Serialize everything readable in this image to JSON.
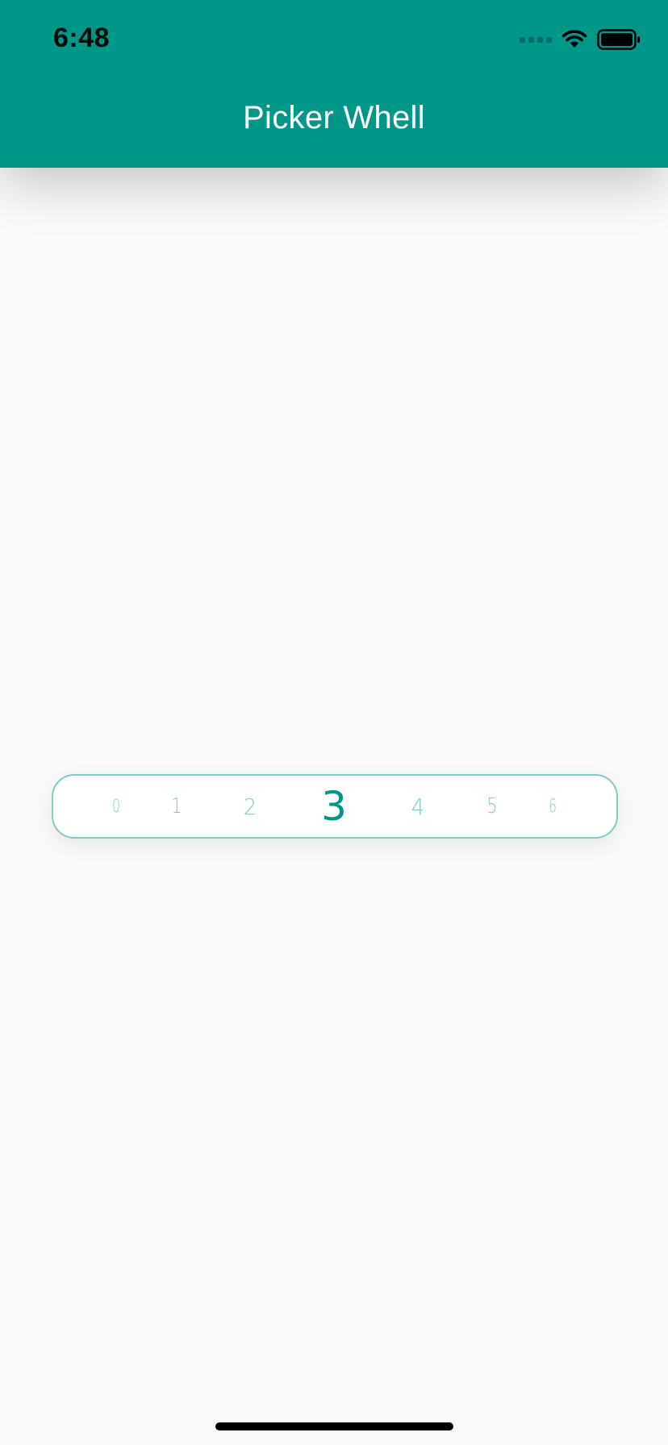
{
  "status_bar": {
    "time": "6:48",
    "icons": [
      "signal-icon",
      "wifi-icon",
      "battery-icon"
    ]
  },
  "app_bar": {
    "title": "Picker Whell",
    "color": "#009688"
  },
  "picker": {
    "items": [
      "0",
      "1",
      "2",
      "3",
      "4",
      "5",
      "6"
    ],
    "selected": "3",
    "accent_color": "#009688",
    "muted_color": "#80cbc4"
  }
}
